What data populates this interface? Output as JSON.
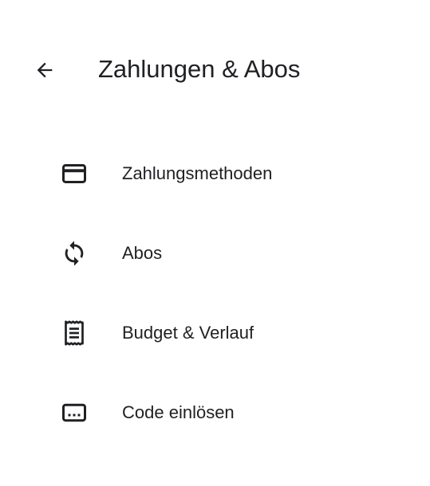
{
  "header": {
    "back_icon": "arrow-back-icon",
    "title": "Zahlungen & Abos"
  },
  "menu": {
    "items": [
      {
        "label": "Zahlungsmethoden",
        "icon": "credit-card-icon"
      },
      {
        "label": "Abos",
        "icon": "sync-icon"
      },
      {
        "label": "Budget & Verlauf",
        "icon": "receipt-icon"
      },
      {
        "label": "Code einlösen",
        "icon": "redeem-code-icon"
      }
    ]
  },
  "colors": {
    "text": "#202124",
    "icon": "#202124",
    "background": "#ffffff"
  }
}
